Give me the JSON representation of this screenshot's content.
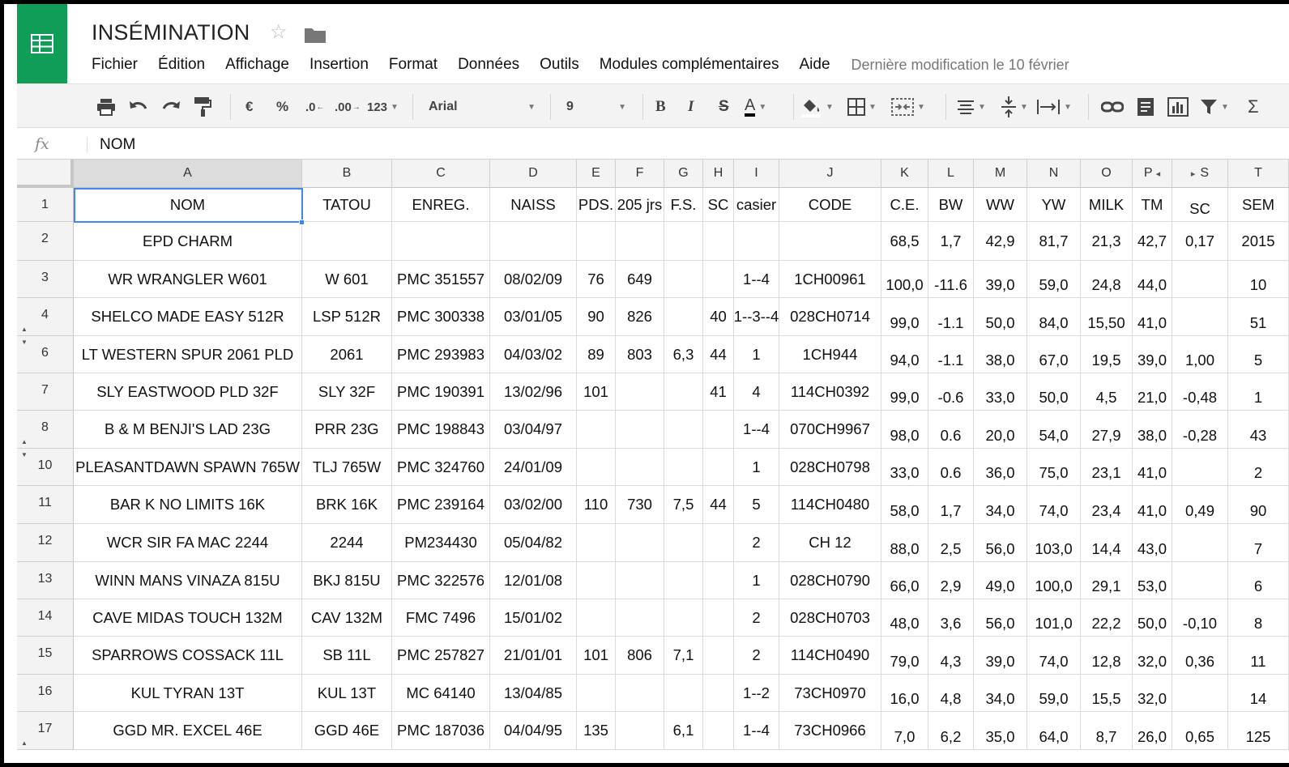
{
  "doc": {
    "title": "INSÉMINATION",
    "star_glyph": "☆"
  },
  "menu": [
    "Fichier",
    "Édition",
    "Affichage",
    "Insertion",
    "Format",
    "Données",
    "Outils",
    "Modules complémentaires",
    "Aide"
  ],
  "last_modified": "Dernière modification le 10 février",
  "toolbar": {
    "currency": "€",
    "percent": "%",
    "dec_less": ".0",
    "dec_more": ".00",
    "more_formats": "123",
    "font": "Arial",
    "font_size": "9",
    "bold": "B",
    "italic": "I",
    "strike": "S",
    "text_color": "A",
    "sum": "Σ"
  },
  "formula_bar": {
    "fx": "fx",
    "value": "NOM"
  },
  "columns": [
    {
      "id": "A",
      "label": "A"
    },
    {
      "id": "B",
      "label": "B"
    },
    {
      "id": "C",
      "label": "C"
    },
    {
      "id": "D",
      "label": "D"
    },
    {
      "id": "E",
      "label": "E"
    },
    {
      "id": "F",
      "label": "F"
    },
    {
      "id": "G",
      "label": "G"
    },
    {
      "id": "H",
      "label": "H"
    },
    {
      "id": "I",
      "label": "I"
    },
    {
      "id": "J",
      "label": "J"
    },
    {
      "id": "K",
      "label": "K"
    },
    {
      "id": "L",
      "label": "L"
    },
    {
      "id": "M",
      "label": "M"
    },
    {
      "id": "N",
      "label": "N"
    },
    {
      "id": "O",
      "label": "O"
    },
    {
      "id": "P",
      "label": "P"
    },
    {
      "id": "S",
      "label": "S"
    },
    {
      "id": "T",
      "label": "T"
    }
  ],
  "selected_cell": "A1",
  "rows": [
    {
      "num": "1",
      "cells": [
        "NOM",
        "TATOU",
        "ENREG.",
        "NAISS",
        "PDS.",
        "205 jrs",
        "F.S.",
        "SC",
        "casier",
        "CODE",
        "C.E.",
        "BW",
        "WW",
        "YW",
        "MILK",
        "TM",
        "SC",
        "SEM"
      ]
    },
    {
      "num": "2",
      "cells": [
        "EPD CHARM",
        "",
        "",
        "",
        "",
        "",
        "",
        "",
        "",
        "",
        "68,5",
        "1,7",
        "42,9",
        "81,7",
        "21,3",
        "42,7",
        "0,17",
        "2015"
      ]
    },
    {
      "num": "3",
      "cells": [
        "WR WRANGLER W601",
        "W 601",
        "PMC 351557",
        "08/02/09",
        "76",
        "649",
        "",
        "",
        "1--4",
        "1CH00961",
        "100,0",
        "-11.6",
        "39,0",
        "59,0",
        "24,8",
        "44,0",
        "",
        "10"
      ]
    },
    {
      "num": "4",
      "cells": [
        "SHELCO MADE EASY 512R",
        "LSP 512R",
        "PMC 300338",
        "03/01/05",
        "90",
        "826",
        "",
        "40",
        "1--3--4",
        "028CH0714",
        "99,0",
        "-1.1",
        "50,0",
        "84,0",
        "15,50",
        "41,0",
        "",
        "51"
      ]
    },
    {
      "num": "6",
      "cells": [
        "LT WESTERN SPUR 2061 PLD",
        "2061",
        "PMC 293983",
        "04/03/02",
        "89",
        "803",
        "6,3",
        "44",
        "1",
        "1CH944",
        "94,0",
        "-1.1",
        "38,0",
        "67,0",
        "19,5",
        "39,0",
        "1,00",
        "5"
      ]
    },
    {
      "num": "7",
      "cells": [
        "SLY EASTWOOD PLD 32F",
        "SLY 32F",
        "PMC 190391",
        "13/02/96",
        "101",
        "",
        "",
        "41",
        "4",
        "114CH0392",
        "99,0",
        "-0.6",
        "33,0",
        "50,0",
        "4,5",
        "21,0",
        "-0,48",
        "1"
      ]
    },
    {
      "num": "8",
      "cells": [
        "B & M BENJI'S LAD 23G",
        "PRR 23G",
        "PMC 198843",
        "03/04/97",
        "",
        "",
        "",
        "",
        "1--4",
        "070CH9967",
        "98,0",
        "0.6",
        "20,0",
        "54,0",
        "27,9",
        "38,0",
        "-0,28",
        "43"
      ]
    },
    {
      "num": "10",
      "cells": [
        "PLEASANTDAWN SPAWN 765W",
        "TLJ 765W",
        "PMC 324760",
        "24/01/09",
        "",
        "",
        "",
        "",
        "1",
        "028CH0798",
        "33,0",
        "0.6",
        "36,0",
        "75,0",
        "23,1",
        "41,0",
        "",
        "2"
      ]
    },
    {
      "num": "11",
      "cells": [
        "BAR K NO LIMITS 16K",
        "BRK 16K",
        "PMC 239164",
        "03/02/00",
        "110",
        "730",
        "7,5",
        "44",
        "5",
        "114CH0480",
        "58,0",
        "1,7",
        "34,0",
        "74,0",
        "23,4",
        "41,0",
        "0,49",
        "90"
      ]
    },
    {
      "num": "12",
      "cells": [
        "WCR SIR FA MAC 2244",
        "2244",
        "PM234430",
        "05/04/82",
        "",
        "",
        "",
        "",
        "2",
        "CH 12",
        "88,0",
        "2,5",
        "56,0",
        "103,0",
        "14,4",
        "43,0",
        "",
        "7"
      ]
    },
    {
      "num": "13",
      "cells": [
        "WINN MANS VINAZA 815U",
        "BKJ 815U",
        "PMC 322576",
        "12/01/08",
        "",
        "",
        "",
        "",
        "1",
        "028CH0790",
        "66,0",
        "2,9",
        "49,0",
        "100,0",
        "29,1",
        "53,0",
        "",
        "6"
      ]
    },
    {
      "num": "14",
      "cells": [
        "CAVE MIDAS TOUCH 132M",
        "CAV 132M",
        "FMC 7496",
        "15/01/02",
        "",
        "",
        "",
        "",
        "2",
        "028CH0703",
        "48,0",
        "3,6",
        "56,0",
        "101,0",
        "22,2",
        "50,0",
        "-0,10",
        "8"
      ]
    },
    {
      "num": "15",
      "cells": [
        "SPARROWS COSSACK 11L",
        "SB 11L",
        "PMC 257827",
        "21/01/01",
        "101",
        "806",
        "7,1",
        "",
        "2",
        "114CH0490",
        "79,0",
        "4,3",
        "39,0",
        "74,0",
        "12,8",
        "32,0",
        "0,36",
        "11"
      ]
    },
    {
      "num": "16",
      "cells": [
        "KUL TYRAN 13T",
        "KUL 13T",
        "MC 64140",
        "13/04/85",
        "",
        "",
        "",
        "",
        "1--2",
        "73CH0970",
        "16,0",
        "4,8",
        "34,0",
        "59,0",
        "15,5",
        "32,0",
        "",
        "14"
      ]
    },
    {
      "num": "17",
      "cells": [
        "GGD MR. EXCEL 46E",
        "GGD 46E",
        "PMC 187036",
        "04/04/95",
        "135",
        "",
        "6,1",
        "",
        "1--4",
        "73CH0966",
        "7,0",
        "6,2",
        "35,0",
        "64,0",
        "8,7",
        "26,0",
        "0,65",
        "125"
      ]
    }
  ],
  "hidden_row_markers": {
    "4": "up",
    "6": "down",
    "8": "up",
    "10": "down",
    "17": "up"
  },
  "colors": {
    "brand": "#0f9d58",
    "selection": "#4285f4"
  }
}
